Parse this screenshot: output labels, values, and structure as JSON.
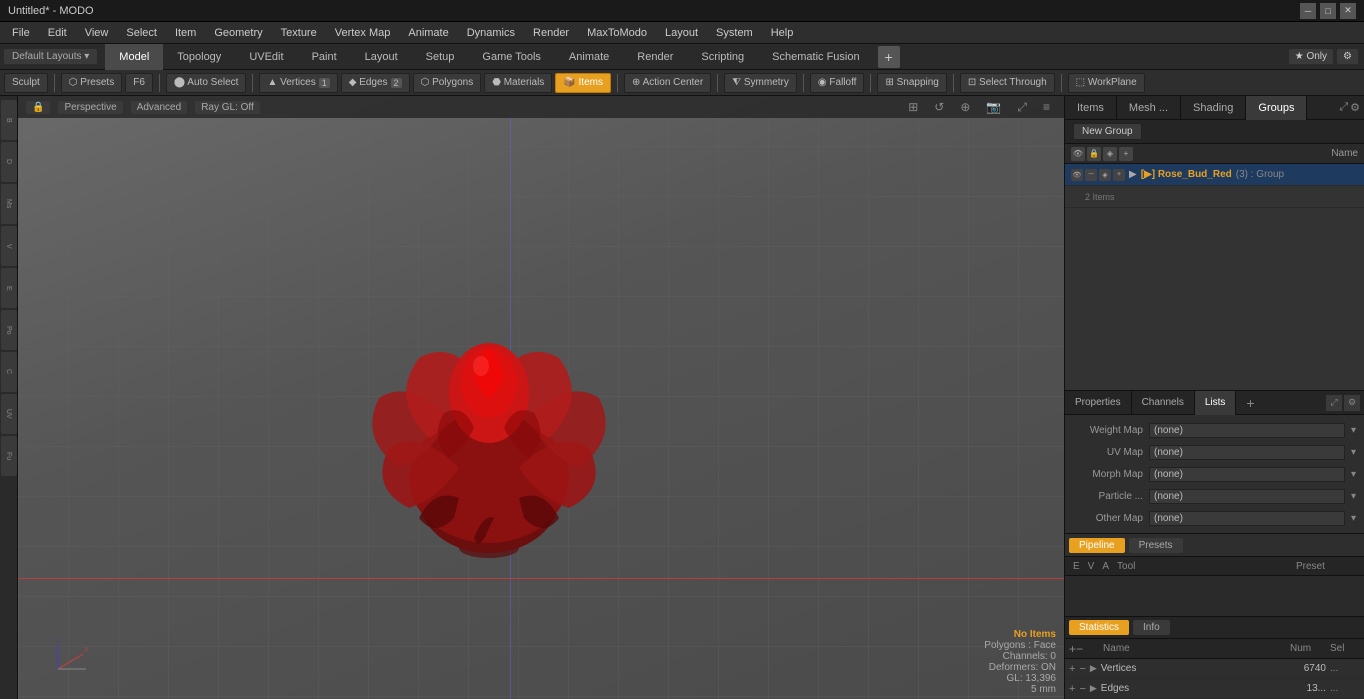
{
  "titlebar": {
    "title": "Untitled* - MODO",
    "controls": [
      "─",
      "□",
      "✕"
    ]
  },
  "menubar": {
    "items": [
      "File",
      "Edit",
      "View",
      "Select",
      "Item",
      "Geometry",
      "Texture",
      "Vertex Map",
      "Animate",
      "Dynamics",
      "Render",
      "MaxToModo",
      "Layout",
      "System",
      "Help"
    ]
  },
  "toolbar_tabs": {
    "items": [
      "Model",
      "Topology",
      "UVEdit",
      "Paint",
      "Layout",
      "Setup",
      "Game Tools",
      "Animate",
      "Render",
      "Scripting",
      "Schematic Fusion"
    ],
    "active": "Model",
    "plus_label": "+"
  },
  "toolbar_right": {
    "only_label": "★ Only",
    "settings_label": "⚙"
  },
  "modebar": {
    "sculpt": "Sculpt",
    "presets": "Presets",
    "f6": "F6",
    "auto_select": "Auto Select",
    "vertices": "Vertices",
    "vertices_count": "1",
    "edges": "Edges",
    "edges_count": "2",
    "polygons": "Polygons",
    "materials": "Materials",
    "items": "Items",
    "action_center": "Action Center",
    "symmetry": "Symmetry",
    "falloff": "Falloff",
    "snapping": "Snapping",
    "select_through": "Select Through",
    "workplane": "WorkPlane"
  },
  "viewport": {
    "perspective": "Perspective",
    "advanced": "Advanced",
    "ray_gl_off": "Ray GL: Off",
    "no_items": "No Items",
    "polygons_face": "Polygons : Face",
    "channels_0": "Channels: 0",
    "deformers_on": "Deformers: ON",
    "gl_count": "GL: 13,396",
    "gl_unit": "5 mm"
  },
  "right_panel": {
    "tabs": [
      "Items",
      "Mesh ...",
      "Shading",
      "Groups"
    ],
    "active_tab": "Groups"
  },
  "items_panel": {
    "new_group_btn": "New Group",
    "table_header": {
      "name": "Name"
    },
    "rows": [
      {
        "name": "Rose_Bud_Red",
        "suffix": "(3)",
        "type": "Group",
        "sub_items": "2 Items"
      }
    ]
  },
  "pcl_tabs": {
    "tabs": [
      "Properties",
      "Channels",
      "Lists"
    ],
    "active": "Lists",
    "plus": "+"
  },
  "maps": {
    "weight_map": {
      "label": "Weight Map",
      "value": "(none)"
    },
    "uv_map": {
      "label": "UV Map",
      "value": "(none)"
    },
    "morph_map": {
      "label": "Morph Map",
      "value": "(none)"
    },
    "particle": {
      "label": "Particle ...",
      "value": "(none)"
    },
    "other_map": {
      "label": "Other Map",
      "value": "(none)"
    }
  },
  "pipeline": {
    "tab_pipeline": "Pipeline",
    "tab_presets": "Presets",
    "cols": {
      "e": "E",
      "v": "V",
      "a": "A",
      "tool": "Tool",
      "preset": "Preset"
    }
  },
  "statistics": {
    "tab_stats": "Statistics",
    "tab_info": "Info",
    "cols": {
      "name": "Name",
      "num": "Num",
      "sel": "Sel"
    },
    "rows": [
      {
        "name": "Vertices",
        "num": "6740",
        "sel": "..."
      },
      {
        "name": "Edges",
        "num": "13...",
        "sel": "..."
      }
    ]
  }
}
